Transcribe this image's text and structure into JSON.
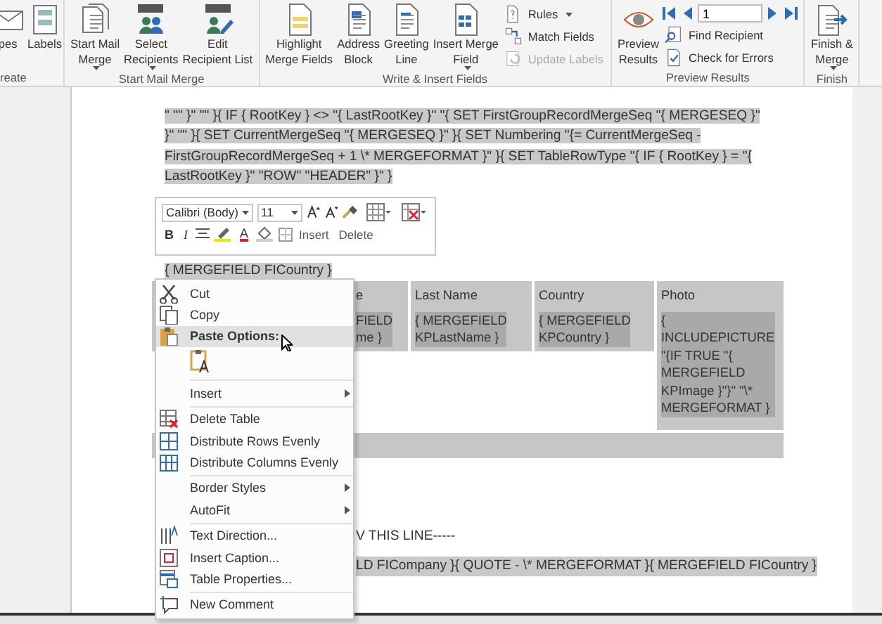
{
  "ribbon": {
    "groups": [
      {
        "label": "reate",
        "items": [
          {
            "kind": "large",
            "lines": [
              "pes"
            ],
            "dropdown": false
          },
          {
            "kind": "large",
            "lines": [
              "Labels"
            ],
            "dropdown": false
          }
        ]
      },
      {
        "label": "Start Mail Merge",
        "items": [
          {
            "kind": "large",
            "lines": [
              "Start Mail",
              "Merge"
            ],
            "dropdown": true
          },
          {
            "kind": "large",
            "lines": [
              "Select",
              "Recipients"
            ],
            "dropdown": true
          },
          {
            "kind": "large",
            "lines": [
              "Edit",
              "Recipient List"
            ],
            "dropdown": false
          }
        ]
      },
      {
        "label": "Write & Insert Fields",
        "items": [
          {
            "kind": "large",
            "lines": [
              "Highlight",
              "Merge Fields"
            ],
            "dropdown": false
          },
          {
            "kind": "large",
            "lines": [
              "Address",
              "Block"
            ],
            "dropdown": false
          },
          {
            "kind": "large",
            "lines": [
              "Greeting",
              "Line"
            ],
            "dropdown": false
          },
          {
            "kind": "large",
            "lines": [
              "Insert Merge",
              "Field"
            ],
            "dropdown": true
          },
          {
            "kind": "small",
            "label": "Rules",
            "dropdown": true,
            "disabled": false
          },
          {
            "kind": "small",
            "label": "Match Fields",
            "dropdown": false,
            "disabled": false
          },
          {
            "kind": "small",
            "label": "Update Labels",
            "dropdown": false,
            "disabled": true
          }
        ]
      },
      {
        "label": "Preview Results",
        "items": [
          {
            "kind": "large",
            "lines": [
              "Preview",
              "Results"
            ],
            "dropdown": false
          },
          {
            "kind": "nav",
            "value": "1"
          },
          {
            "kind": "small",
            "label": "Find Recipient",
            "dropdown": false,
            "disabled": false
          },
          {
            "kind": "small",
            "label": "Check for Errors",
            "dropdown": false,
            "disabled": false
          }
        ]
      },
      {
        "label": "Finish",
        "items": [
          {
            "kind": "large",
            "lines": [
              "Finish &",
              "Merge"
            ],
            "dropdown": true
          }
        ]
      }
    ]
  },
  "document": {
    "field_paragraph": "\" \"\" }\" \"\" }{ IF { RootKey } <> \"{ LastRootKey }\" \"{ SET FirstGroupRecordMergeSeq \"{ MERGESEQ }\" }\" \"\" }{ SET CurrentMergeSeq \"{ MERGESEQ }\" }{ SET Numbering \"{= CurrentMergeSeq - FirstGroupRecordMergeSeq + 1 \\* MERGEFORMAT }\" }{ SET TableRowType \"{ IF { RootKey } = \"{ LastRootKey }\" \"ROW\" \"HEADER\" }\" }",
    "country_field": "{ MERGEFIELD FICountry }",
    "table": {
      "columns": [
        {
          "header": "e",
          "value_lines": [
            "FIELD",
            "me }"
          ]
        },
        {
          "header": "Last Name",
          "value_lines": [
            "{ MERGEFIELD",
            "KPLastName }"
          ]
        },
        {
          "header": "Country",
          "value_lines": [
            "{ MERGEFIELD",
            "KPCountry }"
          ]
        },
        {
          "header": "Photo",
          "value_lines": [
            "{",
            "INCLUDEPICTURE",
            "\"{IF TRUE \"{",
            "MERGEFIELD",
            "KPImage }\"}\" \"\\*",
            "MERGEFORMAT }"
          ]
        }
      ]
    },
    "below_line": "V THIS LINE-----",
    "last_line": "LD FICompany }{ QUOTE - \\* MERGEFORMAT }{ MERGEFIELD FICountry }"
  },
  "mini_toolbar": {
    "font_field": "Calibri (Body)",
    "size_field": "11",
    "bold": "B",
    "italic": "I",
    "font_color": "A",
    "insert": "Insert",
    "delete": "Delete"
  },
  "context_menu": {
    "entries": [
      {
        "kind": "item",
        "label": "Cut",
        "submenu": false,
        "highlighted": false
      },
      {
        "kind": "item",
        "label": "Copy",
        "submenu": false,
        "highlighted": false
      },
      {
        "kind": "header",
        "label": "Paste Options:",
        "submenu": false,
        "highlighted": true
      },
      {
        "kind": "paste-option"
      },
      {
        "kind": "separator"
      },
      {
        "kind": "item",
        "label": "Insert",
        "submenu": true,
        "highlighted": false
      },
      {
        "kind": "separator"
      },
      {
        "kind": "item",
        "label": "Delete Table",
        "submenu": false,
        "highlighted": false
      },
      {
        "kind": "item",
        "label": "Distribute Rows Evenly",
        "submenu": false,
        "highlighted": false
      },
      {
        "kind": "item",
        "label": "Distribute Columns Evenly",
        "submenu": false,
        "highlighted": false
      },
      {
        "kind": "separator"
      },
      {
        "kind": "item",
        "label": "Border Styles",
        "submenu": true,
        "highlighted": false
      },
      {
        "kind": "item",
        "label": "AutoFit",
        "submenu": true,
        "highlighted": false
      },
      {
        "kind": "separator"
      },
      {
        "kind": "item",
        "label": "Text Direction...",
        "submenu": false,
        "highlighted": false
      },
      {
        "kind": "item",
        "label": "Insert Caption...",
        "submenu": false,
        "highlighted": false
      },
      {
        "kind": "item",
        "label": "Table Properties...",
        "submenu": false,
        "highlighted": false
      },
      {
        "kind": "separator"
      },
      {
        "kind": "item",
        "label": "New Comment",
        "submenu": false,
        "highlighted": false
      }
    ]
  }
}
